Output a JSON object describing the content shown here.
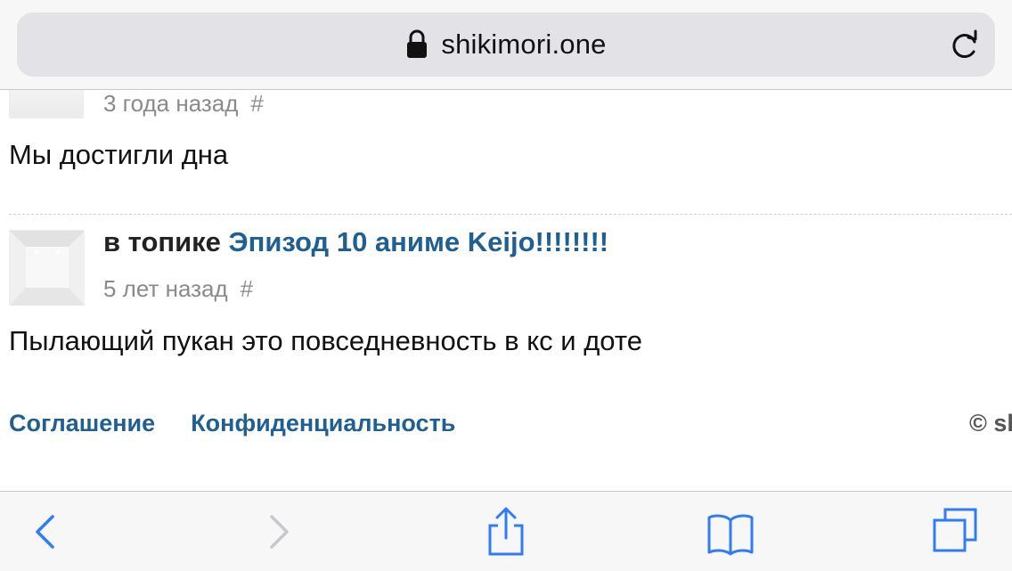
{
  "browser": {
    "url": "shikimori.one",
    "icons": {
      "lock": "lock-icon",
      "reload": "reload-icon",
      "back": "back-icon",
      "forward": "forward-icon",
      "share": "share-icon",
      "bookmarks": "bookmarks-icon",
      "tabs": "tabs-icon"
    },
    "colors": {
      "active_icon": "#2f7cf6",
      "disabled_icon": "#c7c7cc"
    }
  },
  "comments": [
    {
      "time": "3 года назад",
      "hash": "#",
      "text": "Мы достигли дна"
    },
    {
      "topic_prefix": "в топике",
      "topic_title": "Эпизод 10 аниме Keijo!!!!!!!!",
      "time": "5 лет назад",
      "hash": "#",
      "text": "Пылающий пукан это повседневность в кс и доте"
    }
  ],
  "footer": {
    "links": [
      "Соглашение",
      "Конфиденциальность"
    ],
    "copyright": "© sh"
  },
  "colors": {
    "link": "#1f5f92",
    "meta": "#8a8a8a",
    "text": "#111111"
  }
}
